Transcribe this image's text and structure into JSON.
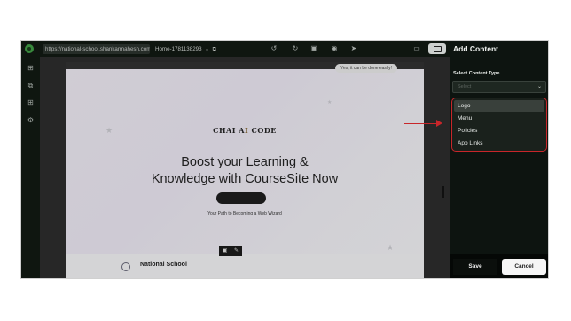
{
  "toolbar": {
    "url": "https://national-school.shankarmahesh.com/",
    "page_selector": "Home-1781138293",
    "icons": [
      "logo-icon",
      "copy-icon",
      "undo-icon",
      "redo-icon",
      "save-icon",
      "preview-icon",
      "publish-icon",
      "desktop-icon",
      "tablet-icon"
    ]
  },
  "rail": {
    "icons": [
      "add-page-icon",
      "layers-icon",
      "components-icon",
      "settings-icon"
    ]
  },
  "preview": {
    "badge_text": "Yes, it can be done easily!",
    "brand_prefix": "CHAI A",
    "brand_ai": "I",
    "brand_suffix": " CODE",
    "hero_line1": "Boost your Learning &",
    "hero_line2": "Knowledge with CourseSite Now",
    "tagline": "Your Path to Becoming a Web Wizard",
    "footer_name": "National School"
  },
  "panel": {
    "title": "Add Content",
    "select_label": "Select Content Type",
    "select_placeholder": "Select",
    "options": [
      "Logo",
      "Menu",
      "Policies",
      "App Links"
    ],
    "active_option": "Logo",
    "save_label": "Save",
    "cancel_label": "Cancel"
  },
  "colors": {
    "accent_annotation": "#c8262a",
    "panel_bg": "#0d1410",
    "brand_green": "#3f9b44"
  }
}
